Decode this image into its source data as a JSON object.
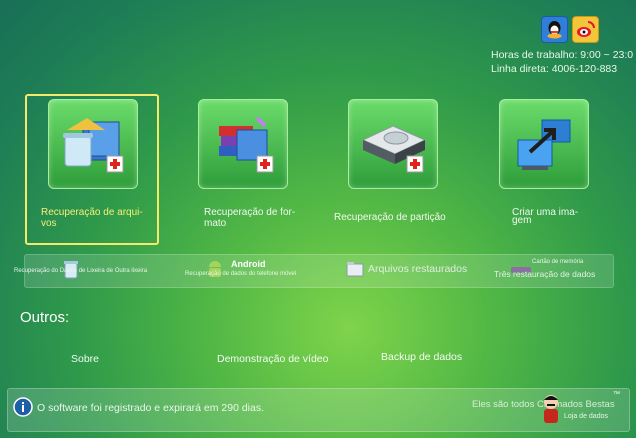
{
  "header": {
    "hours": "Horas de trabalho: 9:00 ~ 23:0",
    "hotline": "Linha direta: 4006-120-883",
    "icons": [
      "qq-icon",
      "weibo-icon"
    ]
  },
  "cards": [
    {
      "label_line1": "Recuperação de arqui-",
      "label_line2": "vos",
      "icon": "recycle-bin-files-icon",
      "selected": true
    },
    {
      "label_line1": "Recuperação de for-",
      "label_line2": "mato",
      "icon": "stacked-files-icon"
    },
    {
      "label_line1": "Recuperação de partição",
      "label_line2": "",
      "icon": "hard-drive-icon"
    },
    {
      "label_line1": "Criar uma ima-",
      "label_line2": "gem",
      "icon": "monitor-arrow-icon"
    }
  ],
  "strip": {
    "item1": "Recuperação do Dados de Lixeira de Outra lixeira",
    "android_title": "Android",
    "android_sub": "Recuperação de dados do telefone móvel",
    "files_restored": "Arquivos restaurados",
    "memory_card": "Cartão de memória",
    "memory_sub": "Três restauração de dados"
  },
  "others": {
    "title": "Outros:",
    "about": "Sobre",
    "demo": "Demonstração de vídeo",
    "backup": "Backup de dados"
  },
  "status": {
    "message": "O software foi registrado e expirará em 290 dias.",
    "brand": "Eles são todos Chamados Bestas",
    "shop": "Loja de dados",
    "tm": "™"
  },
  "colors": {
    "accent_yellow": "#f7ef77",
    "bg_green": "#2f9a4a"
  }
}
